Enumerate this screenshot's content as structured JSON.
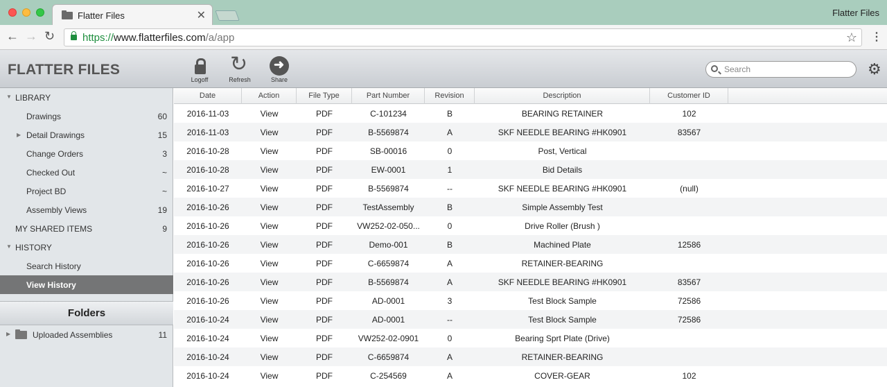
{
  "browser": {
    "tab_title": "Flatter Files",
    "window_title": "Flatter Files",
    "url_scheme": "https://",
    "url_host": "www.flatterfiles.com",
    "url_path": "/a/app",
    "tab_close_glyph": "✕",
    "back_glyph": "←",
    "forward_glyph": "→",
    "reload_glyph": "↻",
    "star_glyph": "☆",
    "menu_glyph": "⋮"
  },
  "app": {
    "logo": "FLATTER FILES",
    "toolbar": {
      "logoff_label": "Logoff",
      "refresh_label": "Refresh",
      "share_label": "Share",
      "refresh_glyph": "↻",
      "share_glyph": "➜"
    },
    "search": {
      "placeholder": "Search"
    },
    "gear_glyph": "⚙"
  },
  "sidebar": {
    "library_label": "LIBRARY",
    "items": [
      {
        "label": "Drawings",
        "count": "60"
      },
      {
        "label": "Detail Drawings",
        "count": "15"
      },
      {
        "label": "Change Orders",
        "count": "3"
      },
      {
        "label": "Checked Out",
        "count": "~"
      },
      {
        "label": "Project BD",
        "count": "~"
      },
      {
        "label": "Assembly Views",
        "count": "19"
      }
    ],
    "shared_label": "MY SHARED ITEMS",
    "shared_count": "9",
    "history_label": "HISTORY",
    "history_items": [
      {
        "label": "Search History"
      },
      {
        "label": "View History"
      }
    ],
    "arrow_down": "▼",
    "arrow_right": "▶",
    "folders_title": "Folders",
    "folders": [
      {
        "label": "Uploaded Assemblies",
        "count": "11"
      }
    ]
  },
  "table": {
    "headers": [
      "Date",
      "Action",
      "File Type",
      "Part Number",
      "Revision",
      "Description",
      "Customer ID"
    ],
    "rows": [
      [
        "2016-11-03",
        "View",
        "PDF",
        "C-101234",
        "B",
        "BEARING RETAINER",
        "102"
      ],
      [
        "2016-11-03",
        "View",
        "PDF",
        "B-5569874",
        "A",
        "SKF NEEDLE BEARING #HK0901",
        "83567"
      ],
      [
        "2016-10-28",
        "View",
        "PDF",
        "SB-00016",
        "0",
        "Post, Vertical",
        ""
      ],
      [
        "2016-10-28",
        "View",
        "PDF",
        "EW-0001",
        "1",
        "Bid Details",
        ""
      ],
      [
        "2016-10-27",
        "View",
        "PDF",
        "B-5569874",
        "--",
        "SKF NEEDLE BEARING #HK0901",
        "(null)"
      ],
      [
        "2016-10-26",
        "View",
        "PDF",
        "TestAssembly",
        "B",
        "Simple Assembly Test",
        ""
      ],
      [
        "2016-10-26",
        "View",
        "PDF",
        "VW252-02-050...",
        "0",
        "Drive Roller (Brush )",
        ""
      ],
      [
        "2016-10-26",
        "View",
        "PDF",
        "Demo-001",
        "B",
        "Machined Plate",
        "12586"
      ],
      [
        "2016-10-26",
        "View",
        "PDF",
        "C-6659874",
        "A",
        "RETAINER-BEARING",
        ""
      ],
      [
        "2016-10-26",
        "View",
        "PDF",
        "B-5569874",
        "A",
        "SKF NEEDLE BEARING #HK0901",
        "83567"
      ],
      [
        "2016-10-26",
        "View",
        "PDF",
        "AD-0001",
        "3",
        "Test Block Sample",
        "72586"
      ],
      [
        "2016-10-24",
        "View",
        "PDF",
        "AD-0001",
        "--",
        "Test Block Sample",
        "72586"
      ],
      [
        "2016-10-24",
        "View",
        "PDF",
        "VW252-02-0901",
        "0",
        "Bearing Sprt  Plate (Drive)",
        ""
      ],
      [
        "2016-10-24",
        "View",
        "PDF",
        "C-6659874",
        "A",
        "RETAINER-BEARING",
        ""
      ],
      [
        "2016-10-24",
        "View",
        "PDF",
        "C-254569",
        "A",
        "COVER-GEAR",
        "102"
      ]
    ]
  }
}
